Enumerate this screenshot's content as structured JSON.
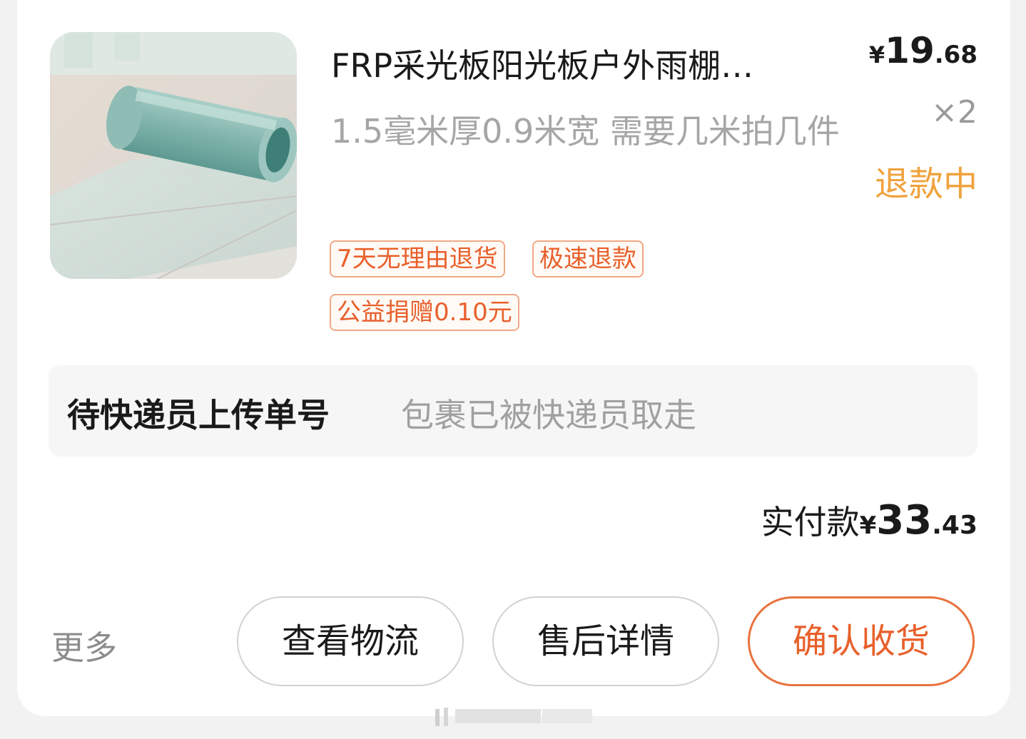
{
  "order": {
    "product_image_label": "product-roll-image",
    "title": "FRP采光板阳光板户外雨棚…",
    "spec": "1.5毫米厚0.9米宽 需要几米拍几件",
    "price": {
      "symbol": "¥",
      "integer": "19",
      "decimal": ".68"
    },
    "quantity": "×2",
    "status": "退款中",
    "tags": [
      "7天无理由退货",
      "极速退款",
      "公益捐赠0.10元"
    ],
    "logistics": {
      "status": "待快递员上传单号",
      "detail": "包裹已被快递员取走"
    },
    "paid": {
      "label": "实付款",
      "symbol": "¥",
      "integer": "33",
      "decimal": ".43"
    }
  },
  "actions": {
    "more": "更多",
    "view_logistics": "查看物流",
    "after_sales": "售后详情",
    "confirm_receipt": "确认收货"
  },
  "colors": {
    "accent": "#e8602b",
    "status": "#f0a23c",
    "muted": "#a6a6a6"
  }
}
